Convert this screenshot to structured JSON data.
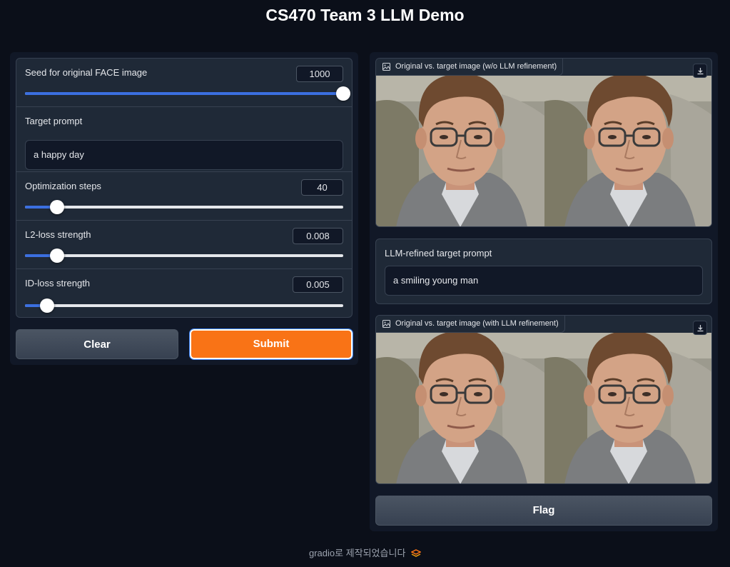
{
  "app": {
    "title": "CS470 Team 3 LLM Demo"
  },
  "inputs": {
    "seed": {
      "label": "Seed for original FACE image",
      "value": "1000",
      "level": 1.0
    },
    "prompt": {
      "label": "Target prompt",
      "value": "a happy day"
    },
    "steps": {
      "label": "Optimization steps",
      "value": "40",
      "level": 0.1
    },
    "l2": {
      "label": "L2-loss strength",
      "value": "0.008",
      "level": 0.1
    },
    "id": {
      "label": "ID-loss strength",
      "value": "0.005",
      "level": 0.07
    }
  },
  "buttons": {
    "clear": "Clear",
    "submit": "Submit",
    "flag": "Flag"
  },
  "outputs": {
    "image1": {
      "label": "Original vs. target image (w/o LLM refinement)"
    },
    "refined": {
      "label": "LLM-refined target prompt",
      "value": "a smiling young man"
    },
    "image2": {
      "label": "Original vs. target image (with LLM refinement)"
    }
  },
  "footer": {
    "text": "gradio로 제작되었습니다"
  },
  "colors": {
    "accent": "#f97316",
    "slider": "#3b6fe0",
    "background": "#0b0f19"
  }
}
